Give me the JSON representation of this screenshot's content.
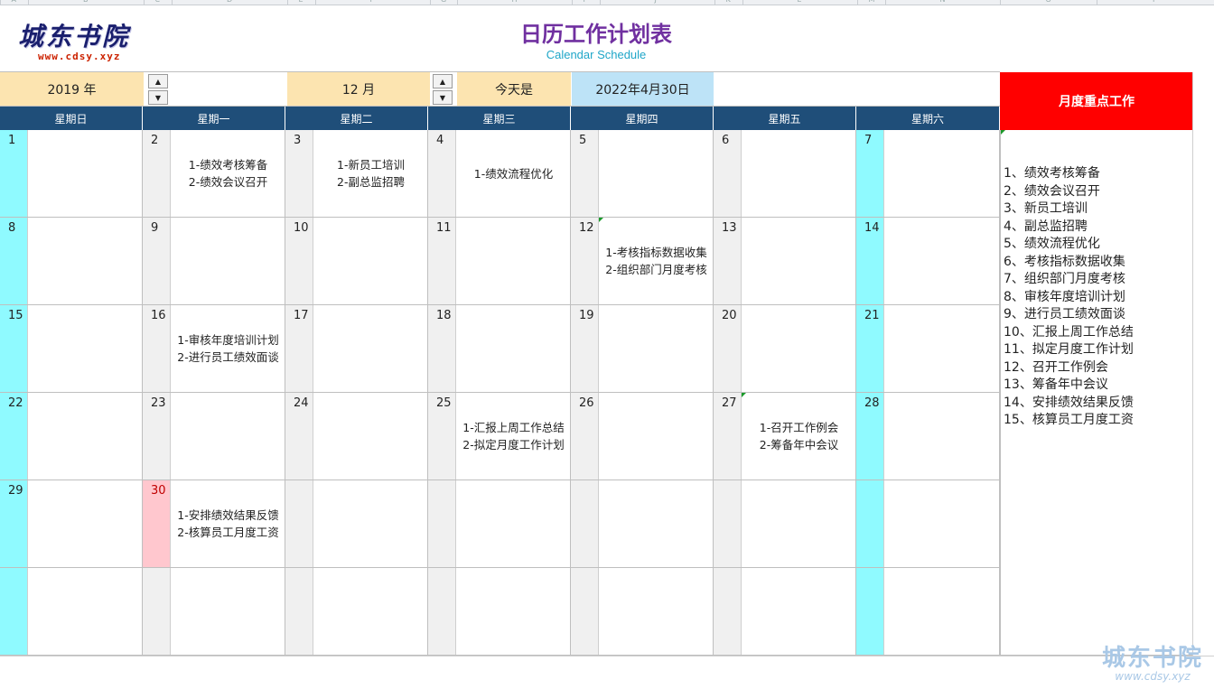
{
  "column_letters": [
    "A",
    "B",
    "C",
    "D",
    "E",
    "F",
    "G",
    "H",
    "I",
    "J",
    "K",
    "L",
    "M",
    "N",
    "O",
    "P"
  ],
  "logo": {
    "text": "城东书院",
    "url": "www.cdsy.xyz"
  },
  "title": "日历工作计划表",
  "subtitle": "Calendar Schedule",
  "year_label": "2019 年",
  "month_label": "12 月",
  "today_label": "今天是",
  "today_value": "2022年4月30日",
  "monthly_header": "月度重点工作",
  "weekdays": [
    "星期日",
    "星期一",
    "星期二",
    "星期三",
    "星期四",
    "星期五",
    "星期六"
  ],
  "weeks": [
    [
      {
        "day": "1",
        "notes": []
      },
      {
        "day": "2",
        "notes": [
          "1-绩效考核筹备",
          "2-绩效会议召开"
        ]
      },
      {
        "day": "3",
        "notes": [
          "1-新员工培训",
          "2-副总监招聘"
        ]
      },
      {
        "day": "4",
        "notes": [
          "1-绩效流程优化"
        ]
      },
      {
        "day": "5",
        "notes": []
      },
      {
        "day": "6",
        "notes": []
      },
      {
        "day": "7",
        "notes": []
      }
    ],
    [
      {
        "day": "8",
        "notes": []
      },
      {
        "day": "9",
        "notes": []
      },
      {
        "day": "10",
        "notes": []
      },
      {
        "day": "11",
        "notes": []
      },
      {
        "day": "12",
        "notes": [
          "1-考核指标数据收集",
          "2-组织部门月度考核"
        ],
        "comment": true
      },
      {
        "day": "13",
        "notes": []
      },
      {
        "day": "14",
        "notes": []
      }
    ],
    [
      {
        "day": "15",
        "notes": []
      },
      {
        "day": "16",
        "notes": [
          "1-审核年度培训计划",
          "2-进行员工绩效面谈"
        ]
      },
      {
        "day": "17",
        "notes": []
      },
      {
        "day": "18",
        "notes": []
      },
      {
        "day": "19",
        "notes": []
      },
      {
        "day": "20",
        "notes": []
      },
      {
        "day": "21",
        "notes": []
      }
    ],
    [
      {
        "day": "22",
        "notes": []
      },
      {
        "day": "23",
        "notes": []
      },
      {
        "day": "24",
        "notes": []
      },
      {
        "day": "25",
        "notes": [
          "1-汇报上周工作总结",
          "2-拟定月度工作计划"
        ]
      },
      {
        "day": "26",
        "notes": []
      },
      {
        "day": "27",
        "notes": [
          "1-召开工作例会",
          "2-筹备年中会议"
        ],
        "comment": true
      },
      {
        "day": "28",
        "notes": []
      }
    ],
    [
      {
        "day": "29",
        "notes": []
      },
      {
        "day": "30",
        "notes": [
          "1-安排绩效结果反馈",
          "2-核算员工月度工资"
        ],
        "today": true
      },
      {
        "day": "",
        "notes": []
      },
      {
        "day": "",
        "notes": []
      },
      {
        "day": "",
        "notes": []
      },
      {
        "day": "",
        "notes": []
      },
      {
        "day": "",
        "notes": []
      }
    ],
    [
      {
        "day": "",
        "notes": []
      },
      {
        "day": "",
        "notes": []
      },
      {
        "day": "",
        "notes": []
      },
      {
        "day": "",
        "notes": []
      },
      {
        "day": "",
        "notes": []
      },
      {
        "day": "",
        "notes": []
      },
      {
        "day": "",
        "notes": []
      }
    ]
  ],
  "monthly_items": [
    "1、绩效考核筹备",
    "2、绩效会议召开",
    "3、新员工培训",
    "4、副总监招聘",
    "5、绩效流程优化",
    "6、考核指标数据收集",
    "7、组织部门月度考核",
    "8、审核年度培训计划",
    "9、进行员工绩效面谈",
    "10、汇报上周工作总结",
    "11、拟定月度工作计划",
    "12、召开工作例会",
    "13、筹备年中会议",
    "14、安排绩效结果反馈",
    "15、核算员工月度工资"
  ],
  "watermark": {
    "text": "城东书院",
    "url": "www.cdsy.xyz"
  },
  "colors": {
    "title": "#7030a0",
    "subtitle": "#1fa6c8",
    "header_bg": "#1f4e79",
    "weekend": "#8ffaff",
    "today": "#ffc7ce",
    "highlight": "#ff0000",
    "input_bg": "#fce4b0",
    "today_bg": "#bde3f7"
  },
  "icons": [
    "spin-up-icon",
    "spin-down-icon",
    "comment-indicator-icon"
  ]
}
